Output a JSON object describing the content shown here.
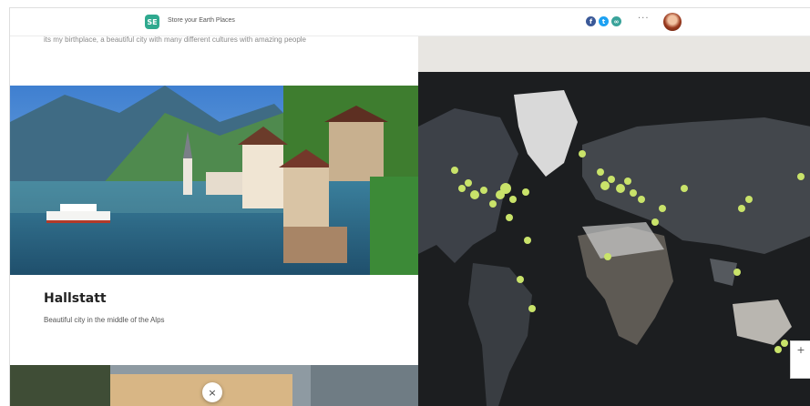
{
  "header": {
    "logo_text": "SE",
    "app_title": "Store your Earth Places",
    "share_icons": [
      "facebook-icon",
      "twitter-icon",
      "link-icon"
    ],
    "more_label": "···"
  },
  "story": {
    "intro_text": "its my birthplace, a beautiful city with many different cultures with amazing people",
    "place_title": "Hallstatt",
    "place_description": "Beautiful city in the middle of the Alps",
    "close_label": "×"
  },
  "map": {
    "zoom_in_label": "+",
    "marker_color": "#c9e36a"
  },
  "colors": {
    "accent": "#2fa98f",
    "map_background": "#1c1e20"
  }
}
